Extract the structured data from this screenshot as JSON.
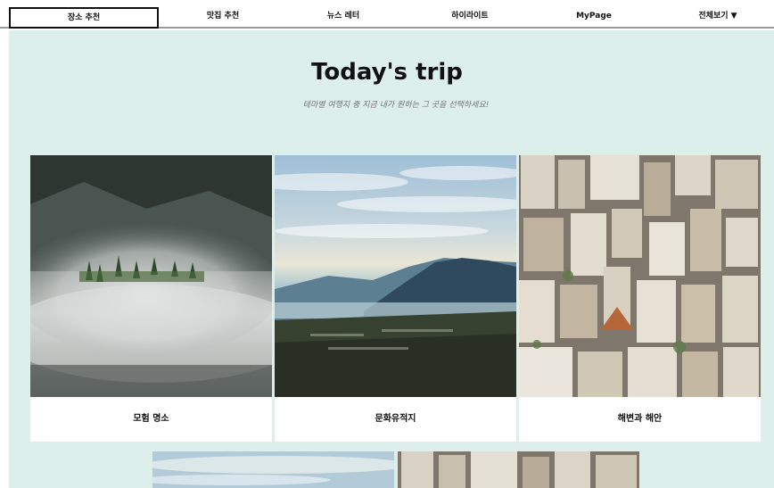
{
  "nav": {
    "items": [
      {
        "label": "장소 추천"
      },
      {
        "label": "맛집 추천"
      },
      {
        "label": "뉴스 레터"
      },
      {
        "label": "하이라이트"
      },
      {
        "label": "MyPage"
      },
      {
        "label": "전체보기 ▼"
      }
    ]
  },
  "hero": {
    "title": "Today's trip",
    "subtitle": "테마별 여행지 중 지금 내가 원하는 그 곳을 선택하세요!"
  },
  "cards": [
    {
      "label": "모험 명소"
    },
    {
      "label": "문화유적지"
    },
    {
      "label": "해변과 해안"
    }
  ],
  "colors": {
    "background": "#dcefea",
    "nav_bg": "#ffffff",
    "text": "#111111"
  }
}
